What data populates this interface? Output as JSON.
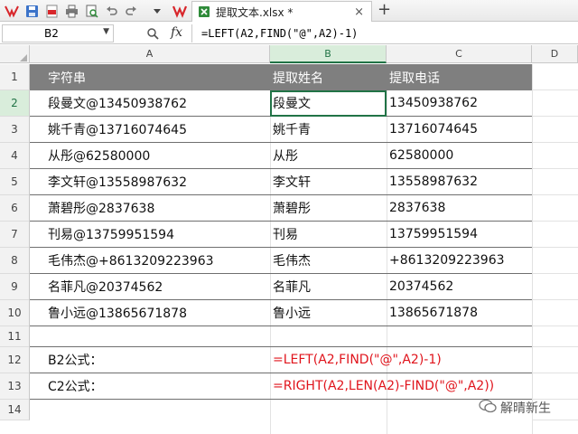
{
  "toolbar": {
    "icons": [
      "wps-logo-icon",
      "save-icon",
      "export-pdf-icon",
      "print-icon",
      "print-preview-icon",
      "undo-icon",
      "redo-icon",
      "dropdown-icon"
    ],
    "tab_name": "提取文本.xlsx *",
    "tab_close": "×",
    "tab_add": "+"
  },
  "formula_bar": {
    "name_box": "B2",
    "fx": "fx",
    "formula": "=LEFT(A2,FIND(\"@\",A2)-1)"
  },
  "columns": [
    "A",
    "B",
    "C",
    "D"
  ],
  "rows": [
    "1",
    "2",
    "3",
    "4",
    "5",
    "6",
    "7",
    "8",
    "9",
    "10",
    "11",
    "12",
    "13",
    "14"
  ],
  "sheet": {
    "header": [
      "字符串",
      "提取姓名",
      "提取电话"
    ],
    "data": [
      [
        "段曼文@13450938762",
        "段曼文",
        "13450938762"
      ],
      [
        "姚千青@13716074645",
        "姚千青",
        "13716074645"
      ],
      [
        "从彤@62580000",
        "从彤",
        "62580000"
      ],
      [
        "李文轩@13558987632",
        "李文轩",
        "13558987632"
      ],
      [
        "萧碧彤@2837638",
        "萧碧彤",
        "2837638"
      ],
      [
        "刊易@13759951594",
        "刊易",
        "13759951594"
      ],
      [
        "毛伟杰@+8613209223963",
        "毛伟杰",
        "+8613209223963"
      ],
      [
        "名菲凡@20374562",
        "名菲凡",
        "20374562"
      ],
      [
        "鲁小远@13865671878",
        "鲁小远",
        "13865671878"
      ]
    ],
    "formula_rows": [
      {
        "label": "B2公式：",
        "formula": "=LEFT(A2,FIND(\"@\",A2)-1)"
      },
      {
        "label": "C2公式：",
        "formula": "=RIGHT(A2,LEN(A2)-FIND(\"@\",A2))"
      }
    ]
  },
  "selected_cell": "B2",
  "watermark": "解晴新生",
  "colors": {
    "header_fill": "#7f7f7f",
    "selection": "#217346",
    "formula_text": "#e0141c"
  }
}
